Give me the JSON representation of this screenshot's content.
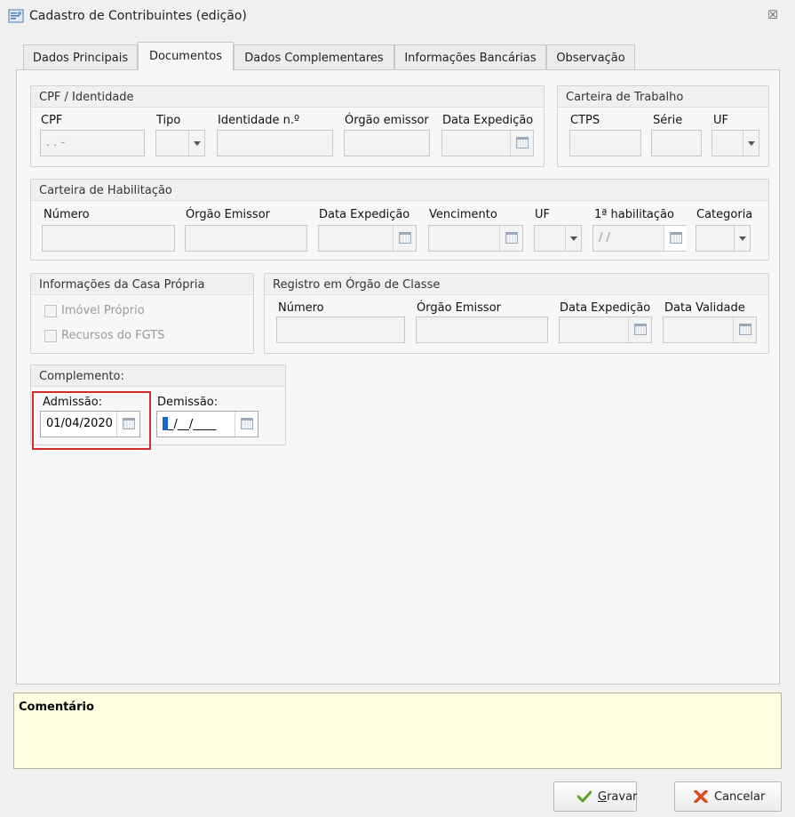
{
  "window": {
    "title": "Cadastro de Contribuintes (edição)",
    "close_glyph": "☒"
  },
  "tabs": [
    {
      "label": "Dados Principais",
      "active": false
    },
    {
      "label": "Documentos",
      "active": true
    },
    {
      "label": "Dados Complementares",
      "active": false
    },
    {
      "label": "Informações Bancárias",
      "active": false
    },
    {
      "label": "Observação",
      "active": false
    }
  ],
  "cpf_group": {
    "title": "CPF / Identidade",
    "labels": {
      "cpf": "CPF",
      "tipo": "Tipo",
      "identidade": "Identidade n.º",
      "orgao": "Órgão emissor",
      "data_exp": "Data Expedição"
    },
    "cpf_value": " .  .  -"
  },
  "ctps_group": {
    "title": "Carteira de Trabalho",
    "labels": {
      "ctps": "CTPS",
      "serie": "Série",
      "uf": "UF"
    }
  },
  "cnh_group": {
    "title": "Carteira de Habilitação",
    "labels": {
      "numero": "Número",
      "orgao": "Órgão Emissor",
      "data_exp": "Data Expedição",
      "vencimento": "Vencimento",
      "uf": "UF",
      "primeira": "1ª habilitação",
      "categoria": "Categoria"
    },
    "primeira_value": " /  /"
  },
  "casa_group": {
    "title": "Informações da Casa Própria",
    "checkboxes": [
      {
        "label": "Imóvel Próprio",
        "checked": false
      },
      {
        "label": "Recursos do FGTS",
        "checked": false
      }
    ]
  },
  "classe_group": {
    "title": "Registro em Órgão de Classe",
    "labels": {
      "numero": "Número",
      "orgao": "Órgão Emissor",
      "data_exp": "Data Expedição",
      "data_val": "Data Validade"
    }
  },
  "complemento_group": {
    "title": "Complemento:",
    "admissao_label": "Admissão:",
    "admissao_value": "01/04/2020",
    "demissao_label": "Demissão:",
    "demissao_value": "_/__/____"
  },
  "comment": {
    "label": "Comentário"
  },
  "buttons": {
    "save": {
      "accel": "G",
      "rest": "ravar"
    },
    "cancel": {
      "label": "Cancelar"
    }
  },
  "icons": {
    "app": "form-icon",
    "calendar": "calendar-icon",
    "save": "checkmark-icon",
    "cancel": "x-icon"
  },
  "colors": {
    "highlight": "#d32a2a",
    "comment_bg": "#ffffe1",
    "save_icon": "#5aa52b",
    "cancel_icon": "#e04b1a"
  }
}
